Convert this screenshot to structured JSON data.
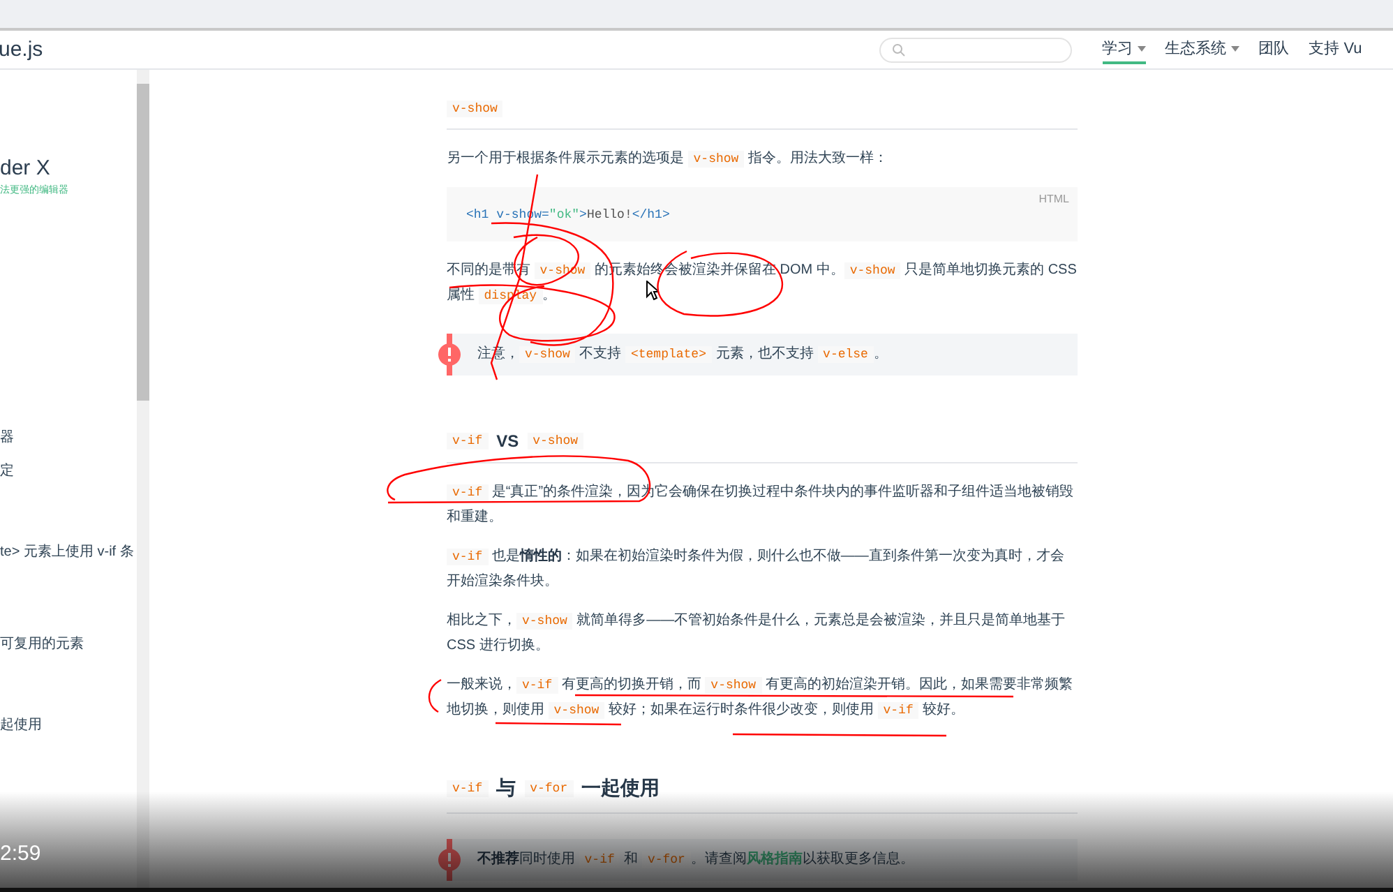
{
  "header": {
    "logo": "ue.js",
    "nav": [
      {
        "label": "学习",
        "dropdown": true,
        "selected": true
      },
      {
        "label": "生态系统",
        "dropdown": true,
        "selected": false
      },
      {
        "label": "团队",
        "dropdown": false,
        "selected": false
      },
      {
        "label": "支持 Vu",
        "dropdown": false,
        "selected": false
      }
    ]
  },
  "sidebar": {
    "ad_title": "der X",
    "ad_subtitle": "法更强的编辑器",
    "items": [
      {
        "label": "器"
      },
      {
        "label": "定"
      },
      {
        "label": "te> 元素上使用 v-if 条"
      },
      {
        "label": "可复用的元素"
      },
      {
        "label": "起使用"
      }
    ]
  },
  "content": [
    {
      "kind": "h3",
      "segments": [
        {
          "kind": "code",
          "text": "v-show"
        }
      ]
    },
    {
      "kind": "p",
      "segments": [
        {
          "kind": "text",
          "text": "另一个用于根据条件展示元素的选项是 "
        },
        {
          "kind": "code",
          "text": "v-show"
        },
        {
          "kind": "text",
          "text": " 指令。用法大致一样："
        }
      ]
    },
    {
      "kind": "code_block",
      "lang": "HTML",
      "segments": [
        {
          "kind": "tag",
          "text": "<h1 "
        },
        {
          "kind": "attr",
          "text": "v-show="
        },
        {
          "kind": "string",
          "text": "\"ok\""
        },
        {
          "kind": "tag",
          "text": ">"
        },
        {
          "kind": "text",
          "text": "Hello!"
        },
        {
          "kind": "tag",
          "text": "</h1>"
        }
      ]
    },
    {
      "kind": "p",
      "segments": [
        {
          "kind": "text",
          "text": "不同的是带有 "
        },
        {
          "kind": "code",
          "text": "v-show"
        },
        {
          "kind": "text",
          "text": " 的元素始终会被渲染并保留在 DOM 中。"
        },
        {
          "kind": "code",
          "text": "v-show"
        },
        {
          "kind": "text",
          "text": " 只是简单地切换元素的 CSS 属性 "
        },
        {
          "kind": "code",
          "text": "display"
        },
        {
          "kind": "text",
          "text": "。"
        }
      ]
    },
    {
      "kind": "tip",
      "segments": [
        {
          "kind": "text",
          "text": "注意，"
        },
        {
          "kind": "code",
          "text": "v-show"
        },
        {
          "kind": "text",
          "text": " 不支持 "
        },
        {
          "kind": "code",
          "text": "<template>"
        },
        {
          "kind": "text",
          "text": " 元素，也不支持 "
        },
        {
          "kind": "code",
          "text": "v-else"
        },
        {
          "kind": "text",
          "text": "。"
        }
      ]
    },
    {
      "kind": "h3",
      "segments": [
        {
          "kind": "code",
          "text": "v-if"
        },
        {
          "kind": "text",
          "text": " VS "
        },
        {
          "kind": "code",
          "text": "v-show"
        }
      ]
    },
    {
      "kind": "p",
      "segments": [
        {
          "kind": "code",
          "text": "v-if"
        },
        {
          "kind": "text",
          "text": " 是“真正”的条件渲染，因为它会确保在切换过程中条件块内的事件监听器和子组件适当地被销毁和重建。"
        }
      ]
    },
    {
      "kind": "p",
      "segments": [
        {
          "kind": "code",
          "text": "v-if"
        },
        {
          "kind": "text",
          "text": " 也是"
        },
        {
          "kind": "bold",
          "text": "惰性的"
        },
        {
          "kind": "text",
          "text": "：如果在初始渲染时条件为假，则什么也不做——直到条件第一次变为真时，才会开始渲染条件块。"
        }
      ]
    },
    {
      "kind": "p",
      "segments": [
        {
          "kind": "text",
          "text": "相比之下，"
        },
        {
          "kind": "code",
          "text": "v-show"
        },
        {
          "kind": "text",
          "text": " 就简单得多——不管初始条件是什么，元素总是会被渲染，并且只是简单地基于 CSS 进行切换。"
        }
      ]
    },
    {
      "kind": "p",
      "segments": [
        {
          "kind": "text",
          "text": "一般来说，"
        },
        {
          "kind": "code",
          "text": "v-if"
        },
        {
          "kind": "text",
          "text": " 有更高的切换开销，而 "
        },
        {
          "kind": "code",
          "text": "v-show"
        },
        {
          "kind": "text",
          "text": " 有更高的初始渲染开销。因此，如果需要非常频繁地切换，则使用 "
        },
        {
          "kind": "code",
          "text": "v-show"
        },
        {
          "kind": "text",
          "text": " 较好；如果在运行时条件很少改变，则使用 "
        },
        {
          "kind": "code",
          "text": "v-if"
        },
        {
          "kind": "text",
          "text": " 较好。"
        }
      ]
    },
    {
      "kind": "h2",
      "segments": [
        {
          "kind": "code",
          "text": "v-if"
        },
        {
          "kind": "text",
          "text": " 与 "
        },
        {
          "kind": "code",
          "text": "v-for"
        },
        {
          "kind": "text",
          "text": " 一起使用"
        }
      ]
    },
    {
      "kind": "tip",
      "segments": [
        {
          "kind": "bold",
          "text": "不推荐"
        },
        {
          "kind": "text",
          "text": "同时使用 "
        },
        {
          "kind": "code",
          "text": "v-if"
        },
        {
          "kind": "text",
          "text": " 和 "
        },
        {
          "kind": "code",
          "text": "v-for"
        },
        {
          "kind": "text",
          "text": "。请查阅"
        },
        {
          "kind": "link",
          "text": "风格指南"
        },
        {
          "kind": "text",
          "text": "以获取更多信息。"
        }
      ]
    }
  ],
  "video": {
    "time": "2:59"
  }
}
